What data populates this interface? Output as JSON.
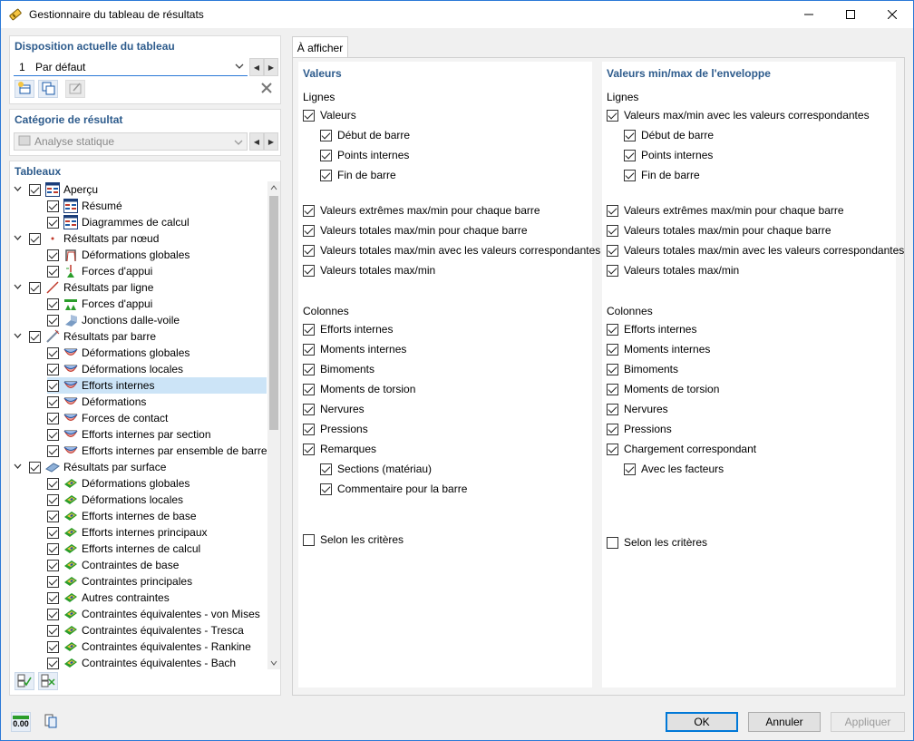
{
  "window": {
    "title": "Gestionnaire du tableau de résultats"
  },
  "layout": {
    "title": "Disposition actuelle du tableau",
    "number": "1",
    "value": "Par défaut"
  },
  "category": {
    "title": "Catégorie de résultat",
    "value": "Analyse statique"
  },
  "tables": {
    "title": "Tableaux",
    "items": [
      {
        "label": "Aperçu",
        "level": 0,
        "icon": "overview-icon"
      },
      {
        "label": "Résumé",
        "level": 1,
        "icon": "summary-table-icon"
      },
      {
        "label": "Diagrammes de calcul",
        "level": 1,
        "icon": "design-diagram-icon"
      },
      {
        "label": "Résultats par nœud",
        "level": 0,
        "icon": "node-icon"
      },
      {
        "label": "Déformations globales",
        "level": 1,
        "icon": "node-deformation-icon"
      },
      {
        "label": "Forces d'appui",
        "level": 1,
        "icon": "nodal-support-icon"
      },
      {
        "label": "Résultats par ligne",
        "level": 0,
        "icon": "line-icon"
      },
      {
        "label": "Forces d'appui",
        "level": 1,
        "icon": "line-support-icon"
      },
      {
        "label": "Jonctions dalle-voile",
        "level": 1,
        "icon": "slab-wall-icon"
      },
      {
        "label": "Résultats par barre",
        "level": 0,
        "icon": "member-icon"
      },
      {
        "label": "Déformations globales",
        "level": 1,
        "icon": "member-diagram-icon"
      },
      {
        "label": "Déformations locales",
        "level": 1,
        "icon": "member-diagram-icon"
      },
      {
        "label": "Efforts internes",
        "level": 1,
        "icon": "member-diagram-icon",
        "selected": true
      },
      {
        "label": "Déformations",
        "level": 1,
        "icon": "member-diagram-icon"
      },
      {
        "label": "Forces de contact",
        "level": 1,
        "icon": "member-diagram-icon"
      },
      {
        "label": "Efforts internes par section",
        "level": 1,
        "icon": "member-diagram-icon"
      },
      {
        "label": "Efforts internes par ensemble de barres",
        "level": 1,
        "icon": "member-diagram-icon"
      },
      {
        "label": "Résultats par surface",
        "level": 0,
        "icon": "surface-icon"
      },
      {
        "label": "Déformations globales",
        "level": 1,
        "icon": "surface-result-icon"
      },
      {
        "label": "Déformations locales",
        "level": 1,
        "icon": "surface-result-icon"
      },
      {
        "label": "Efforts internes de base",
        "level": 1,
        "icon": "surface-result-icon"
      },
      {
        "label": "Efforts internes principaux",
        "level": 1,
        "icon": "surface-result-icon"
      },
      {
        "label": "Efforts internes de calcul",
        "level": 1,
        "icon": "surface-result-icon"
      },
      {
        "label": "Contraintes de base",
        "level": 1,
        "icon": "surface-result-icon"
      },
      {
        "label": "Contraintes principales",
        "level": 1,
        "icon": "surface-result-icon"
      },
      {
        "label": "Autres contraintes",
        "level": 1,
        "icon": "surface-result-icon"
      },
      {
        "label": "Contraintes équivalentes - von Mises",
        "level": 1,
        "icon": "surface-result-icon"
      },
      {
        "label": "Contraintes équivalentes - Tresca",
        "level": 1,
        "icon": "surface-result-icon"
      },
      {
        "label": "Contraintes équivalentes - Rankine",
        "level": 1,
        "icon": "surface-result-icon"
      },
      {
        "label": "Contraintes équivalentes - Bach",
        "level": 1,
        "icon": "surface-result-icon"
      }
    ]
  },
  "tab": {
    "label": "À afficher"
  },
  "left": {
    "title": "Valeurs",
    "lines_label": "Lignes",
    "lines": [
      {
        "label": "Valeurs",
        "checked": true,
        "indent": 0
      },
      {
        "label": "Début de barre",
        "checked": true,
        "indent": 1
      },
      {
        "label": "Points internes",
        "checked": true,
        "indent": 1
      },
      {
        "label": "Fin de barre",
        "checked": true,
        "indent": 1
      },
      {
        "label": "Valeurs extrêmes max/min pour chaque barre",
        "checked": true,
        "indent": 0,
        "gap": true
      },
      {
        "label": "Valeurs totales max/min pour chaque barre",
        "checked": true,
        "indent": 0
      },
      {
        "label": "Valeurs totales max/min avec les valeurs correspondantes",
        "checked": true,
        "indent": 0
      },
      {
        "label": "Valeurs totales max/min",
        "checked": true,
        "indent": 0
      }
    ],
    "columns_label": "Colonnes",
    "columns": [
      {
        "label": "Efforts internes",
        "checked": true,
        "indent": 0
      },
      {
        "label": "Moments internes",
        "checked": true,
        "indent": 0
      },
      {
        "label": "Bimoments",
        "checked": true,
        "indent": 0
      },
      {
        "label": "Moments de torsion",
        "checked": true,
        "indent": 0
      },
      {
        "label": "Nervures",
        "checked": true,
        "indent": 0
      },
      {
        "label": "Pressions",
        "checked": true,
        "indent": 0
      },
      {
        "label": "Remarques",
        "checked": true,
        "indent": 0
      },
      {
        "label": "Sections (matériau)",
        "checked": true,
        "indent": 1
      },
      {
        "label": "Commentaire pour la barre",
        "checked": true,
        "indent": 1
      }
    ],
    "criteria": {
      "label": "Selon les critères",
      "checked": false
    }
  },
  "right": {
    "title": "Valeurs min/max de l'enveloppe",
    "lines_label": "Lignes",
    "lines": [
      {
        "label": "Valeurs max/min avec les valeurs correspondantes",
        "checked": true,
        "indent": 0
      },
      {
        "label": "Début de barre",
        "checked": true,
        "indent": 1
      },
      {
        "label": "Points internes",
        "checked": true,
        "indent": 1
      },
      {
        "label": "Fin de barre",
        "checked": true,
        "indent": 1
      },
      {
        "label": "Valeurs extrêmes max/min pour chaque barre",
        "checked": true,
        "indent": 0,
        "gap": true
      },
      {
        "label": "Valeurs totales max/min pour chaque barre",
        "checked": true,
        "indent": 0
      },
      {
        "label": "Valeurs totales max/min avec les valeurs correspondantes",
        "checked": true,
        "indent": 0
      },
      {
        "label": "Valeurs totales max/min",
        "checked": true,
        "indent": 0
      }
    ],
    "columns_label": "Colonnes",
    "columns": [
      {
        "label": "Efforts internes",
        "checked": true,
        "indent": 0
      },
      {
        "label": "Moments internes",
        "checked": true,
        "indent": 0
      },
      {
        "label": "Bimoments",
        "checked": true,
        "indent": 0
      },
      {
        "label": "Moments de torsion",
        "checked": true,
        "indent": 0
      },
      {
        "label": "Nervures",
        "checked": true,
        "indent": 0
      },
      {
        "label": "Pressions",
        "checked": true,
        "indent": 0
      },
      {
        "label": "Chargement correspondant",
        "checked": true,
        "indent": 0
      },
      {
        "label": "Avec les facteurs",
        "checked": true,
        "indent": 1
      }
    ],
    "criteria": {
      "label": "Selon les critères",
      "checked": false
    }
  },
  "buttons": {
    "ok": "OK",
    "cancel": "Annuler",
    "apply": "Appliquer"
  },
  "bottom_icon_text": "0.00"
}
